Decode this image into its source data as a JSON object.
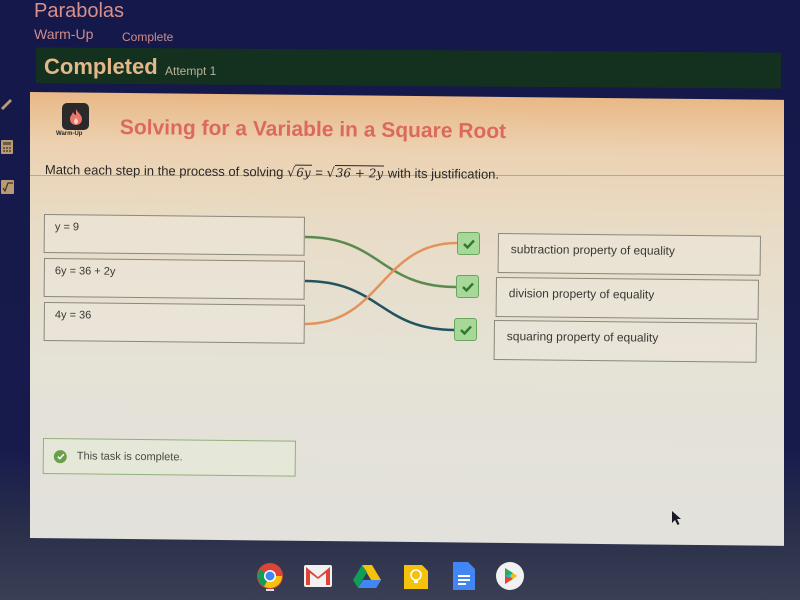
{
  "header": {
    "course_title": "Parabolas",
    "activity_type": "Warm-Up",
    "activity_status": "Complete",
    "completed_label": "Completed",
    "attempt_label": "Attempt 1"
  },
  "side_tools": [
    {
      "name": "pencil-icon",
      "glyph": "✎"
    },
    {
      "name": "calculator-icon",
      "glyph": "▦"
    },
    {
      "name": "formula-icon",
      "glyph": "√x"
    }
  ],
  "lesson": {
    "icon_label": "Warm-Up",
    "title": "Solving for a Variable in a Square Root",
    "instruction_prefix": "Match each step in the process of solving ",
    "eq_left_radicand": "6y",
    "eq_equals": " = ",
    "eq_right_radicand": "36 + 2y",
    "instruction_suffix": " with its justification."
  },
  "matching": {
    "left_items": [
      {
        "label": "y = 9"
      },
      {
        "label": "6y = 36 + 2y"
      },
      {
        "label": "4y = 36"
      }
    ],
    "right_items": [
      {
        "label": "subtraction property of equality"
      },
      {
        "label": "division property of equality"
      },
      {
        "label": "squaring property of equality"
      }
    ],
    "connections": [
      {
        "from": 0,
        "to": 1,
        "color": "#5a8a4e"
      },
      {
        "from": 1,
        "to": 2,
        "color": "#23535e"
      },
      {
        "from": 2,
        "to": 0,
        "color": "#e2925a"
      }
    ],
    "all_correct": true
  },
  "status": {
    "message": "This task is complete."
  },
  "dock": [
    {
      "name": "chrome-icon"
    },
    {
      "name": "gmail-icon"
    },
    {
      "name": "drive-icon"
    },
    {
      "name": "keep-icon"
    },
    {
      "name": "docs-icon"
    },
    {
      "name": "play-store-icon"
    }
  ],
  "colors": {
    "title_accent": "#db6a5c",
    "completed_bar": "#14301f",
    "check_green": "#a8d79a"
  }
}
